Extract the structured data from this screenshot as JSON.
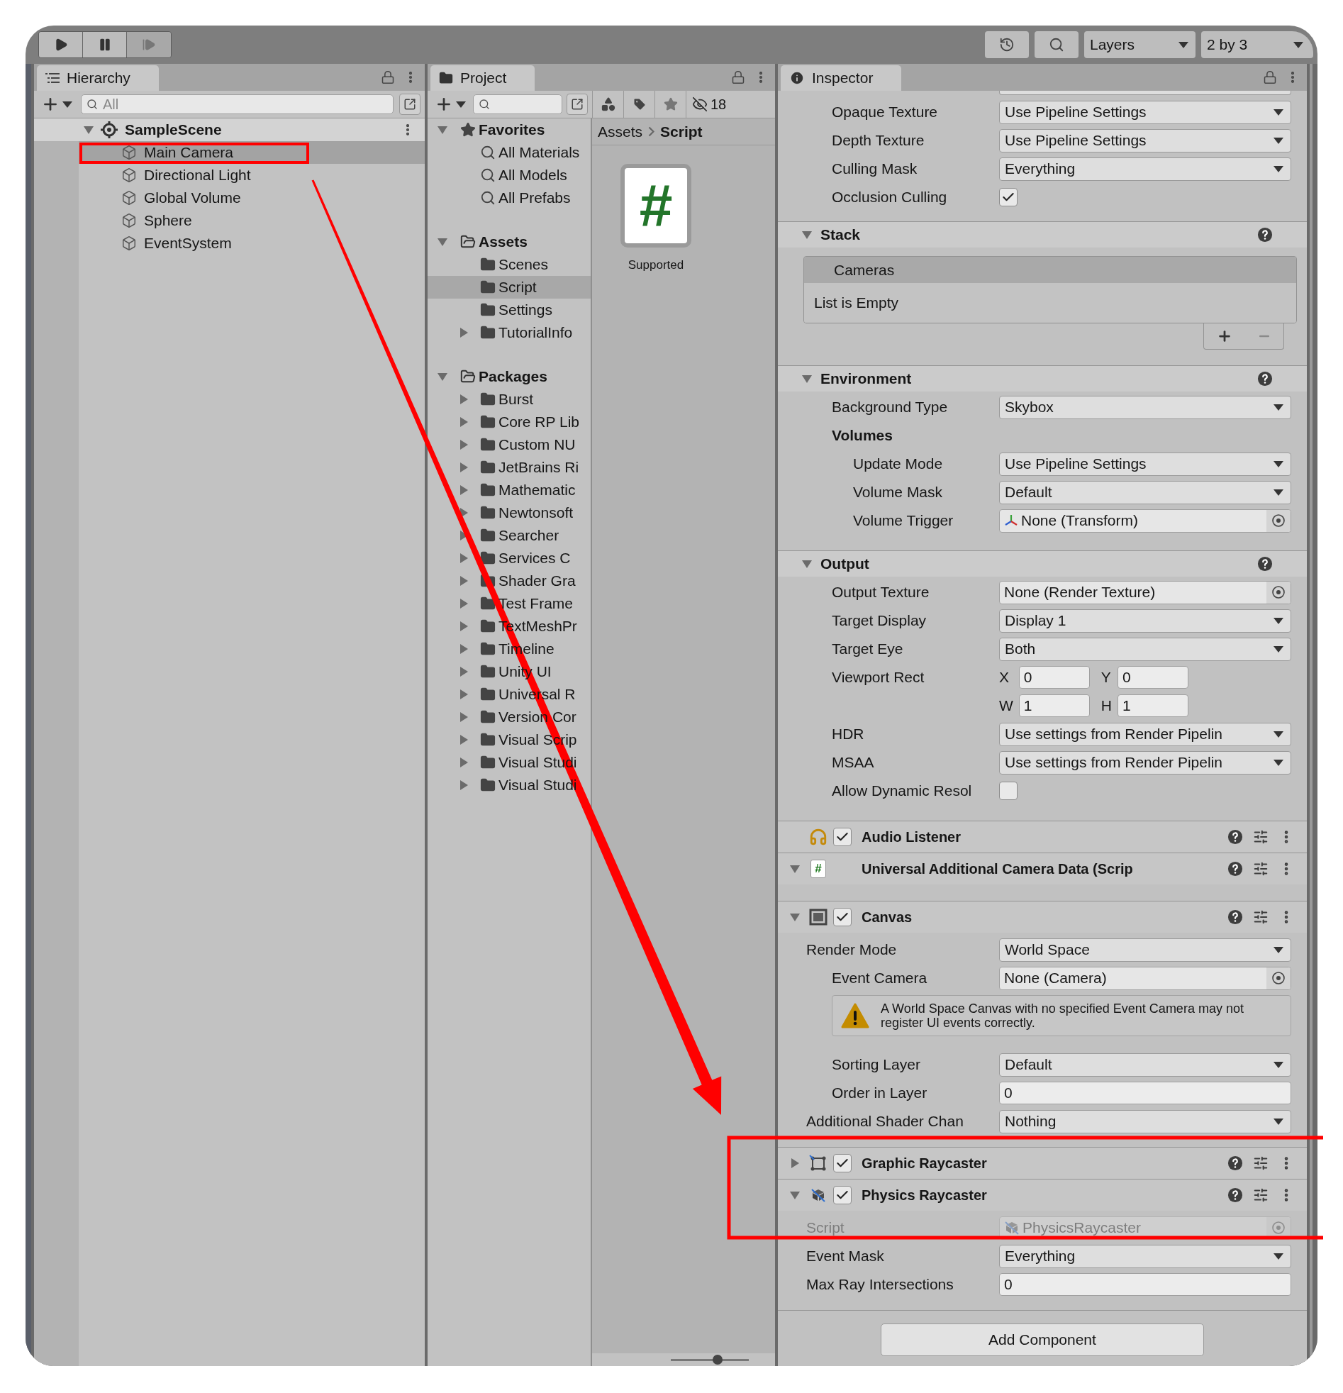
{
  "toolbar": {
    "layers": "Layers",
    "layout": "2 by 3"
  },
  "hierarchy": {
    "tab": "Hierarchy",
    "search": {
      "placeholder": "All"
    },
    "scene": {
      "name": "SampleScene",
      "expanded": true,
      "selected": false,
      "children": [
        {
          "name": "Main Camera",
          "selected": true
        },
        {
          "name": "Directional Light",
          "selected": false
        },
        {
          "name": "Global Volume",
          "selected": false
        },
        {
          "name": "Sphere",
          "selected": false
        },
        {
          "name": "EventSystem",
          "selected": false
        }
      ]
    }
  },
  "project": {
    "tab": "Project",
    "hidden_count": "18",
    "tree": [
      {
        "name": "Favorites",
        "kind": "favorites",
        "expanded": true,
        "selected": false,
        "children": [
          {
            "name": "All Materials",
            "kind": "search",
            "selected": false
          },
          {
            "name": "All Models",
            "kind": "search",
            "selected": false
          },
          {
            "name": "All Prefabs",
            "kind": "search",
            "selected": false
          }
        ]
      },
      {
        "name": "Assets",
        "kind": "folder",
        "expanded": true,
        "selected": false,
        "children": [
          {
            "name": "Scenes",
            "kind": "folder",
            "selected": false
          },
          {
            "name": "Script",
            "kind": "folder",
            "selected": true
          },
          {
            "name": "Settings",
            "kind": "folder",
            "selected": false
          },
          {
            "name": "TutorialInfo",
            "kind": "folder",
            "selected": false,
            "expanded": false
          }
        ]
      },
      {
        "name": "Packages",
        "kind": "folder",
        "expanded": true,
        "selected": false,
        "children": [
          {
            "name": "Burst",
            "kind": "folder",
            "selected": false,
            "expanded": false
          },
          {
            "name": "Core RP Lib",
            "kind": "folder",
            "selected": false,
            "expanded": false
          },
          {
            "name": "Custom NU",
            "kind": "folder",
            "selected": false,
            "expanded": false
          },
          {
            "name": "JetBrains Ri",
            "kind": "folder",
            "selected": false,
            "expanded": false
          },
          {
            "name": "Mathematic",
            "kind": "folder",
            "selected": false,
            "expanded": false
          },
          {
            "name": "Newtonsoft",
            "kind": "folder",
            "selected": false,
            "expanded": false
          },
          {
            "name": "Searcher",
            "kind": "folder",
            "selected": false,
            "expanded": false
          },
          {
            "name": "Services C",
            "kind": "folder",
            "selected": false,
            "expanded": false
          },
          {
            "name": "Shader Gra",
            "kind": "folder",
            "selected": false,
            "expanded": false
          },
          {
            "name": "Test Frame",
            "kind": "folder",
            "selected": false,
            "expanded": false
          },
          {
            "name": "TextMeshPr",
            "kind": "folder",
            "selected": false,
            "expanded": false
          },
          {
            "name": "Timeline",
            "kind": "folder",
            "selected": false,
            "expanded": false
          },
          {
            "name": "Unity UI",
            "kind": "folder",
            "selected": false,
            "expanded": false
          },
          {
            "name": "Universal R",
            "kind": "folder",
            "selected": false,
            "expanded": false
          },
          {
            "name": "Version Cor",
            "kind": "folder",
            "selected": false,
            "expanded": false
          },
          {
            "name": "Visual Scrip",
            "kind": "folder",
            "selected": false,
            "expanded": false
          },
          {
            "name": "Visual Studi",
            "kind": "folder",
            "selected": false,
            "expanded": false
          },
          {
            "name": "Visual Studi",
            "kind": "folder",
            "selected": false,
            "expanded": false
          }
        ]
      }
    ],
    "breadcrumb": [
      "Assets",
      "Script"
    ],
    "assets": [
      {
        "name": "Supported",
        "glyph": "#"
      }
    ],
    "zoom_slider": {
      "level": 0.6
    }
  },
  "inspector": {
    "tab": "Inspector",
    "blocks": [
      {
        "kind": "fields",
        "rows": [
          {
            "kind": "dropdown",
            "label": "Opaque Texture",
            "value": "Use Pipeline Settings"
          },
          {
            "kind": "dropdown",
            "label": "Depth Texture",
            "value": "Use Pipeline Settings"
          },
          {
            "kind": "dropdown",
            "label": "Culling Mask",
            "value": "Everything"
          },
          {
            "kind": "checkbox",
            "label": "Occlusion Culling",
            "checked": true
          }
        ]
      },
      {
        "kind": "section",
        "title": "Stack",
        "expanded": true,
        "list": {
          "header": "Cameras",
          "empty_text": "List is Empty"
        }
      },
      {
        "kind": "section",
        "title": "Environment",
        "expanded": true,
        "rows": [
          {
            "kind": "dropdown",
            "label": "Background Type",
            "value": "Skybox"
          },
          {
            "kind": "group",
            "label": "Volumes",
            "children": [
              {
                "kind": "dropdown",
                "label": "Update Mode",
                "value": "Use Pipeline Settings"
              },
              {
                "kind": "dropdown",
                "label": "Volume Mask",
                "value": "Default"
              },
              {
                "kind": "transform",
                "label": "Volume Trigger",
                "value": "None (Transform)"
              }
            ]
          }
        ]
      },
      {
        "kind": "section",
        "title": "Output",
        "expanded": true,
        "rows": [
          {
            "kind": "object",
            "label": "Output Texture",
            "value": "None (Render Texture)"
          },
          {
            "kind": "dropdown",
            "label": "Target Display",
            "value": "Display 1"
          },
          {
            "kind": "dropdown",
            "label": "Target Eye",
            "value": "Both"
          },
          {
            "kind": "rect",
            "label": "Viewport Rect",
            "fields": [
              {
                "axis": "X",
                "value": "0"
              },
              {
                "axis": "Y",
                "value": "0"
              },
              {
                "axis": "W",
                "value": "1"
              },
              {
                "axis": "H",
                "value": "1"
              }
            ]
          },
          {
            "kind": "dropdown",
            "label": "HDR",
            "value": "Use settings from Render Pipelin"
          },
          {
            "kind": "dropdown",
            "label": "MSAA",
            "value": "Use settings from Render Pipelin"
          },
          {
            "kind": "checkbox",
            "label": "Allow Dynamic Resol",
            "checked": false
          }
        ]
      },
      {
        "kind": "component",
        "title": "Audio Listener",
        "enabled": true
      },
      {
        "kind": "component",
        "title": "Universal Additional Camera Data (Scrip",
        "expanded": true,
        "glyph": "#"
      },
      {
        "kind": "component",
        "title": "Canvas",
        "expanded": true,
        "enabled": true,
        "rows": [
          {
            "kind": "dropdown",
            "label": "Render Mode",
            "value": "World Space",
            "children": [
              {
                "kind": "object",
                "label": "Event Camera",
                "value": "None (Camera)"
              },
              {
                "kind": "warning",
                "text": "A World Space Canvas with no specified Event Camera may not register UI events correctly."
              },
              {
                "kind": "dropdown",
                "label": "Sorting Layer",
                "value": "Default"
              },
              {
                "kind": "text",
                "label": "Order in Layer",
                "value": "0"
              }
            ]
          },
          {
            "kind": "dropdown",
            "label": "Additional Shader Chan",
            "value": "Nothing"
          }
        ]
      },
      {
        "kind": "component",
        "title": "Graphic Raycaster",
        "expanded": false,
        "enabled": true
      },
      {
        "kind": "component",
        "title": "Physics Raycaster",
        "expanded": true,
        "enabled": true,
        "rows": [
          {
            "kind": "script",
            "label": "Script",
            "value": "PhysicsRaycaster",
            "disabled": true
          },
          {
            "kind": "dropdown",
            "label": "Event Mask",
            "value": "Everything",
            "disabled": false
          },
          {
            "kind": "text",
            "label": "Max Ray Intersections",
            "value": "0",
            "disabled": false
          }
        ]
      }
    ],
    "add_component": "Add Component"
  }
}
